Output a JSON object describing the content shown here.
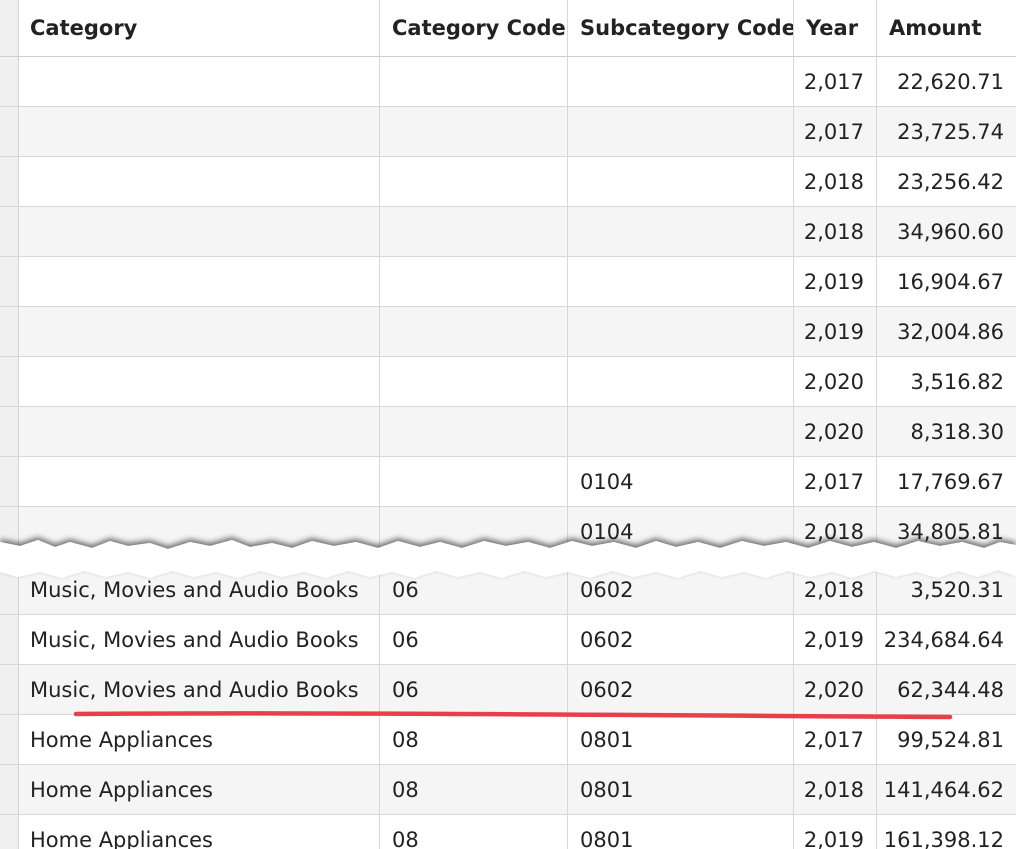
{
  "table": {
    "columns": [
      "Category",
      "Category Code",
      "Subcategory Code",
      "Year",
      "Amount"
    ],
    "top_rows": [
      {
        "category": "",
        "category_code": "",
        "subcategory_code": "",
        "year": "2,017",
        "amount": "22,620.71"
      },
      {
        "category": "",
        "category_code": "",
        "subcategory_code": "",
        "year": "2,017",
        "amount": "23,725.74"
      },
      {
        "category": "",
        "category_code": "",
        "subcategory_code": "",
        "year": "2,018",
        "amount": "23,256.42"
      },
      {
        "category": "",
        "category_code": "",
        "subcategory_code": "",
        "year": "2,018",
        "amount": "34,960.60"
      },
      {
        "category": "",
        "category_code": "",
        "subcategory_code": "",
        "year": "2,019",
        "amount": "16,904.67"
      },
      {
        "category": "",
        "category_code": "",
        "subcategory_code": "",
        "year": "2,019",
        "amount": "32,004.86"
      },
      {
        "category": "",
        "category_code": "",
        "subcategory_code": "",
        "year": "2,020",
        "amount": "3,516.82"
      },
      {
        "category": "",
        "category_code": "",
        "subcategory_code": "",
        "year": "2,020",
        "amount": "8,318.30"
      },
      {
        "category": "",
        "category_code": "",
        "subcategory_code": "0104",
        "year": "2,017",
        "amount": "17,769.67"
      },
      {
        "category": "",
        "category_code": "",
        "subcategory_code": "0104",
        "year": "2,018",
        "amount": "34,805.81"
      }
    ],
    "bottom_rows": [
      {
        "category": "Music, Movies and Audio Books",
        "category_code": "06",
        "subcategory_code": "0602",
        "year": "2,018",
        "amount": "3,520.31"
      },
      {
        "category": "Music, Movies and Audio Books",
        "category_code": "06",
        "subcategory_code": "0602",
        "year": "2,019",
        "amount": "234,684.64"
      },
      {
        "category": "Music, Movies and Audio Books",
        "category_code": "06",
        "subcategory_code": "0602",
        "year": "2,020",
        "amount": "62,344.48"
      },
      {
        "category": "Home Appliances",
        "category_code": "08",
        "subcategory_code": "0801",
        "year": "2,017",
        "amount": "99,524.81"
      },
      {
        "category": "Home Appliances",
        "category_code": "08",
        "subcategory_code": "0801",
        "year": "2,018",
        "amount": "141,464.62"
      },
      {
        "category": "Home Appliances",
        "category_code": "08",
        "subcategory_code": "0801",
        "year": "2,019",
        "amount": "161,398.12"
      }
    ]
  },
  "colors": {
    "highlight_underline": "#e8404a",
    "row_alt": "#f5f5f5",
    "grid_line": "#d8d8d8"
  }
}
